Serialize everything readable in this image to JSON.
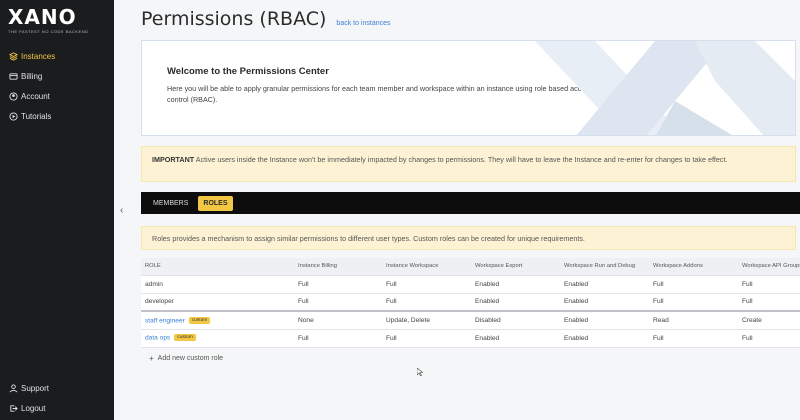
{
  "sidebar": {
    "logo": "XANO",
    "logo_tagline": "THE FASTEST NO CODE BACKEND",
    "items": [
      {
        "label": "Instances",
        "icon": "stack-icon",
        "active": true
      },
      {
        "label": "Billing",
        "icon": "credit-card-icon"
      },
      {
        "label": "Account",
        "icon": "user-icon"
      },
      {
        "label": "Tutorials",
        "icon": "play-icon"
      }
    ],
    "bottom_items": [
      {
        "label": "Support",
        "icon": "support-icon"
      },
      {
        "label": "Logout",
        "icon": "logout-icon"
      }
    ],
    "collapse_icon": "chevron-left-icon"
  },
  "header": {
    "title": "Permissions (RBAC)",
    "back_link": "back to instances"
  },
  "welcome": {
    "title": "Welcome to the Permissions Center",
    "text": "Here you will be able to apply granular permissions for each team member and workspace within an instance using role based access control (RBAC)."
  },
  "important": {
    "label": "IMPORTANT",
    "text": " Active users inside the Instance won't be immediately impacted by changes to permissions. They will have to leave the Instance and re-enter for changes to take effect."
  },
  "tabs": {
    "items": [
      "Members",
      "Roles"
    ],
    "inactive_label": "MEMBERS",
    "active_label": "ROLES"
  },
  "roles_info": "Roles provides a mechanism to assign similar permissions to different user types. Custom roles can be created for unique requirements.",
  "table": {
    "columns": [
      "ROLE",
      "Instance Billing",
      "Instance Workspace",
      "Workspace Export",
      "Workspace Run and Debug",
      "Workspace Addons",
      "Workspace API Groups"
    ],
    "custom_badge": "custom",
    "rows": [
      {
        "role": "admin",
        "custom": false,
        "cells": [
          "Full",
          "Full",
          "Enabled",
          "Enabled",
          "Full",
          "Full"
        ]
      },
      {
        "role": "developer",
        "custom": false,
        "cells": [
          "Full",
          "Full",
          "Enabled",
          "Enabled",
          "Full",
          "Full"
        ]
      },
      {
        "role": "staff engineer",
        "custom": true,
        "cells": [
          "None",
          "Update, Delete",
          "Disabled",
          "Enabled",
          "Read",
          "Create"
        ]
      },
      {
        "role": "data ops",
        "custom": true,
        "cells": [
          "Full",
          "Full",
          "Enabled",
          "Enabled",
          "Full",
          "Full"
        ]
      }
    ]
  },
  "add_role": "Add new custom role",
  "colors": {
    "accent": "#f2c744",
    "link": "#3b7fd6",
    "sidebar_bg": "#1b1c1e",
    "notice_bg": "#fdf3d4"
  }
}
